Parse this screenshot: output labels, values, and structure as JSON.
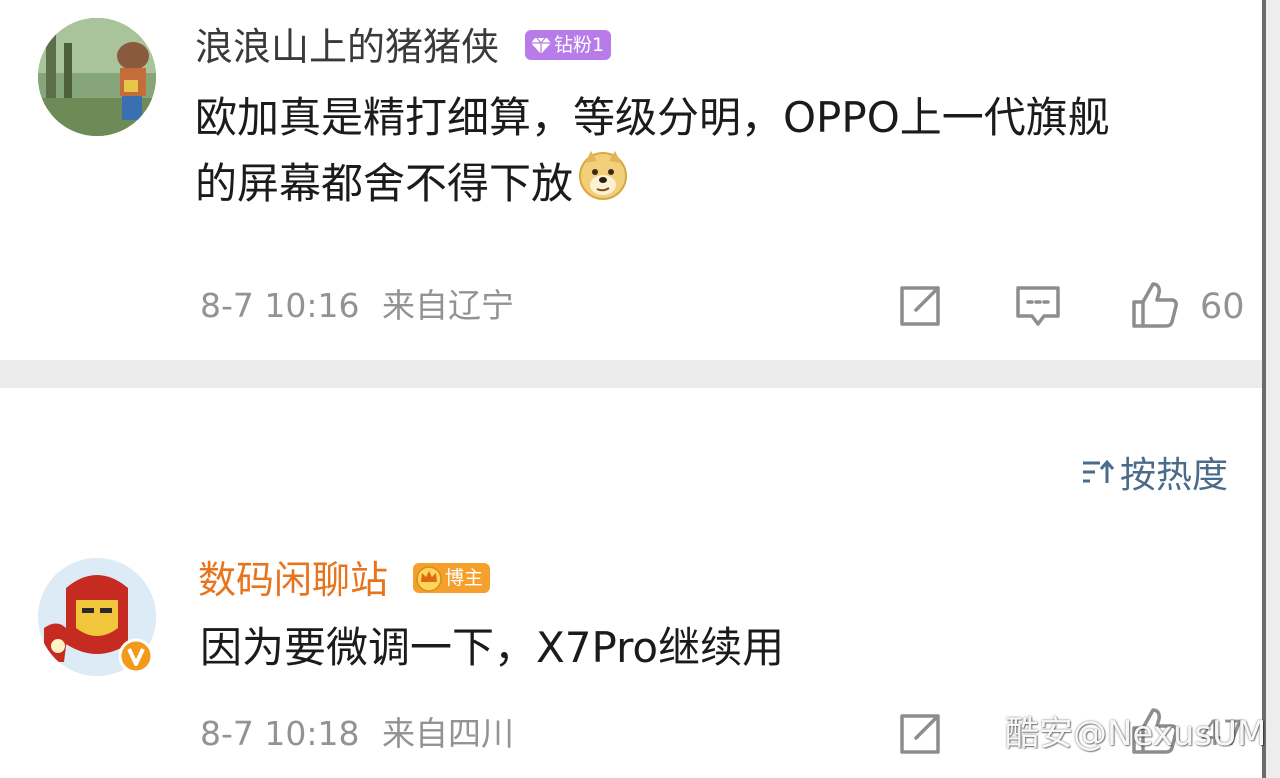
{
  "comments": [
    {
      "username": "浪浪山上的猪猪侠",
      "badge": "钻粉1",
      "content_line1": "欧加真是精打细算，等级分明，OPPO上一代旗舰",
      "content_line2": "的屏幕都舍不得下放",
      "emoji": "doge-emoji",
      "time": "8-7 10:16",
      "location": "来自辽宁",
      "likes": "60"
    },
    {
      "username": "数码闲聊站",
      "badge": "博主",
      "content_line1": "因为要微调一下，X7Pro继续用",
      "time": "8-7 10:18",
      "location": "来自四川",
      "likes": "47"
    }
  ],
  "sort": {
    "label": "按热度"
  },
  "watermark": "酷安@NexusUM",
  "colors": {
    "username_default": "#3a3a3a",
    "username_blogger": "#e8741d",
    "badge_diamond": "#b77ce9",
    "badge_blogger": "#f5a02c",
    "meta": "#939393",
    "sort": "#4b6b8a"
  }
}
